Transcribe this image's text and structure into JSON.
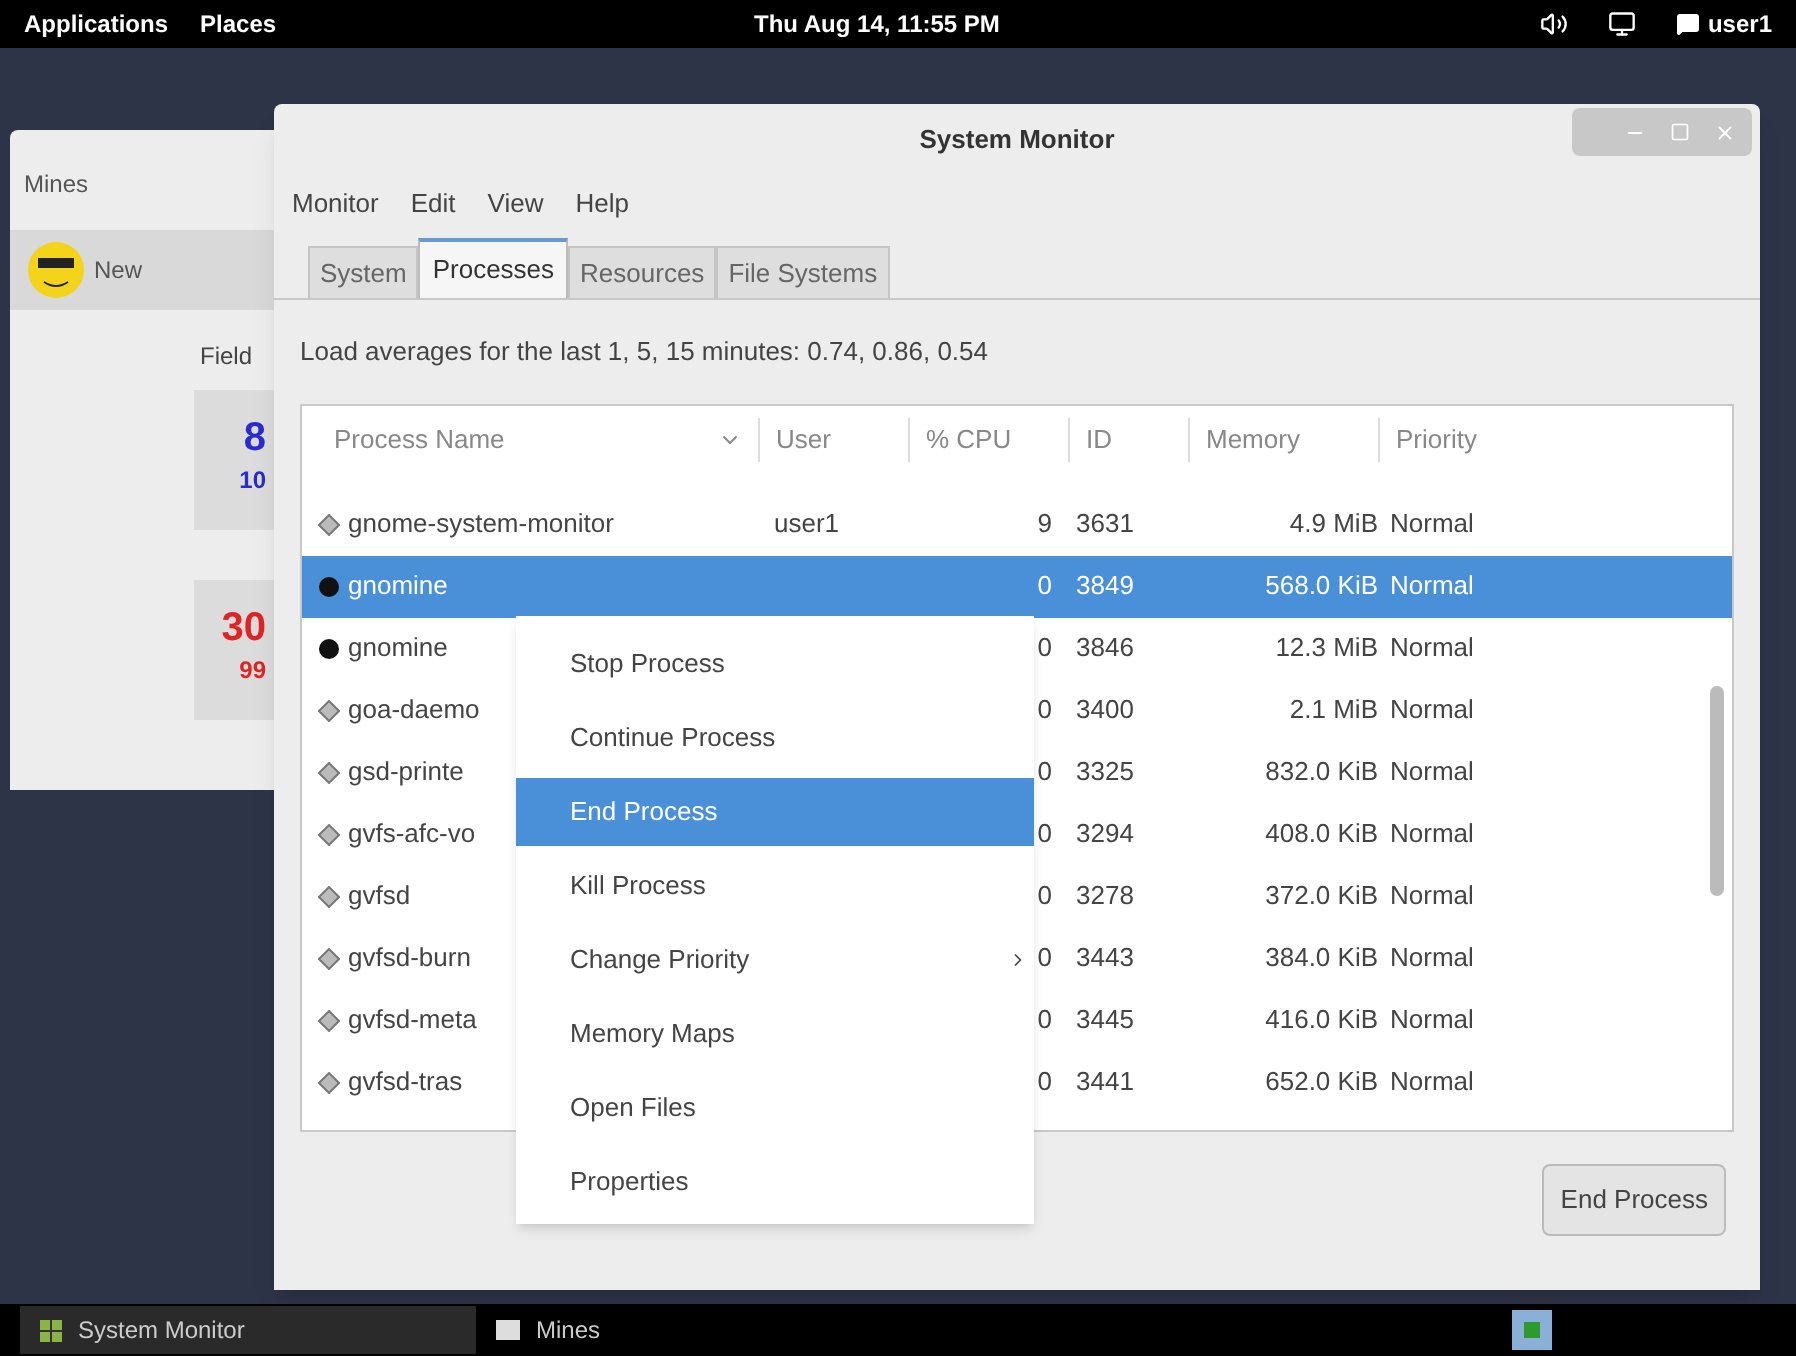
{
  "top_bar": {
    "menus": [
      "Applications",
      "Places"
    ],
    "clock": "Thu Aug 14, 11:55 PM",
    "user": "user1"
  },
  "mines_window": {
    "title": "Mines",
    "toolbar_button": "New",
    "field_label": "Field",
    "counters": [
      {
        "value": "8",
        "sub": "10",
        "color": "#2b2bd0"
      },
      {
        "value": "30",
        "sub": "99",
        "color": "#e02424"
      }
    ]
  },
  "system_monitor": {
    "title": "System Monitor",
    "menu": [
      "Monitor",
      "Edit",
      "View",
      "Help"
    ],
    "tabs": [
      {
        "label": "System",
        "selected": false
      },
      {
        "label": "Processes",
        "selected": true
      },
      {
        "label": "Resources",
        "selected": false
      },
      {
        "label": "File Systems",
        "selected": false
      }
    ],
    "load_text": "Load averages for the last 1, 5, 15 minutes: 0.74, 0.86, 0.54",
    "columns": [
      {
        "label": "Process Name",
        "sorted": true
      },
      {
        "label": "User",
        "sorted": false
      },
      {
        "label": "% CPU",
        "sorted": false
      },
      {
        "label": "ID",
        "sorted": false
      },
      {
        "label": "Memory",
        "sorted": false
      },
      {
        "label": "Priority",
        "sorted": false
      }
    ],
    "rows": [
      {
        "kind": "daemon",
        "name": "gnome-system-monitor",
        "user": "user1",
        "cpu": "9",
        "id": "3631",
        "memory": "4.9 MiB",
        "priority": "Normal",
        "selected": false
      },
      {
        "kind": "game",
        "name": "gnomine",
        "cpu": "0",
        "id": "3849",
        "memory": "568.0 KiB",
        "priority": "Normal",
        "selected": true
      },
      {
        "kind": "game",
        "name": "gnomine",
        "cpu": "0",
        "id": "3846",
        "memory": "12.3 MiB",
        "priority": "Normal",
        "selected": false
      },
      {
        "kind": "daemon",
        "name": "goa-daemo",
        "cpu": "0",
        "id": "3400",
        "memory": "2.1 MiB",
        "priority": "Normal",
        "selected": false
      },
      {
        "kind": "daemon",
        "name": "gsd-printe",
        "cpu": "0",
        "id": "3325",
        "memory": "832.0 KiB",
        "priority": "Normal",
        "selected": false
      },
      {
        "kind": "daemon",
        "name": "gvfs-afc-vo",
        "cpu": "0",
        "id": "3294",
        "memory": "408.0 KiB",
        "priority": "Normal",
        "selected": false
      },
      {
        "kind": "daemon",
        "name": "gvfsd",
        "cpu": "0",
        "id": "3278",
        "memory": "372.0 KiB",
        "priority": "Normal",
        "selected": false
      },
      {
        "kind": "daemon",
        "name": "gvfsd-burn",
        "cpu": "0",
        "id": "3443",
        "memory": "384.0 KiB",
        "priority": "Normal",
        "selected": false
      },
      {
        "kind": "daemon",
        "name": "gvfsd-meta",
        "cpu": "0",
        "id": "3445",
        "memory": "416.0 KiB",
        "priority": "Normal",
        "selected": false
      },
      {
        "kind": "daemon",
        "name": "gvfsd-tras",
        "cpu": "0",
        "id": "3441",
        "memory": "652.0 KiB",
        "priority": "Normal",
        "selected": false
      }
    ],
    "context_menu": [
      {
        "label": "Stop Process",
        "selected": false,
        "submenu": false
      },
      {
        "label": "Continue Process",
        "selected": false,
        "submenu": false
      },
      {
        "label": "End Process",
        "selected": true,
        "submenu": false
      },
      {
        "label": "Kill Process",
        "selected": false,
        "submenu": false
      },
      {
        "label": "Change Priority",
        "selected": false,
        "submenu": true
      },
      {
        "label": "Memory Maps",
        "selected": false,
        "submenu": false
      },
      {
        "label": "Open Files",
        "selected": false,
        "submenu": false
      },
      {
        "label": "Properties",
        "selected": false,
        "submenu": false
      }
    ],
    "end_button": "End Process"
  },
  "taskbar": [
    {
      "label": "System Monitor",
      "selected": true
    },
    {
      "label": "Mines",
      "selected": false
    }
  ]
}
